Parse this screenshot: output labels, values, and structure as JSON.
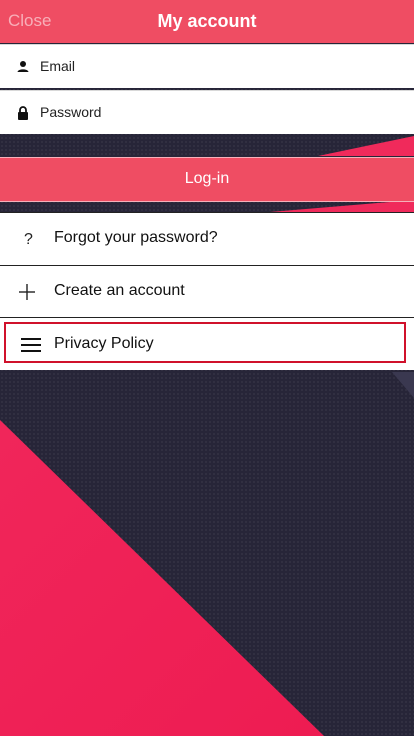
{
  "header": {
    "close_label": "Close",
    "title": "My account"
  },
  "form": {
    "email": {
      "placeholder": "Email",
      "icon": "user-icon"
    },
    "password": {
      "placeholder": "Password",
      "icon": "lock-icon"
    },
    "login_label": "Log-in"
  },
  "menu": {
    "forgot": {
      "label": "Forgot your password?",
      "icon": "question-icon"
    },
    "create": {
      "label": "Create an account",
      "icon": "plus-icon"
    },
    "privacy": {
      "label": "Privacy Policy",
      "icon": "hamburger-icon"
    }
  },
  "colors": {
    "accent": "#ef4d63",
    "background": "#272538",
    "background_shape": "#f01f55",
    "highlight_border": "#d0112b"
  }
}
